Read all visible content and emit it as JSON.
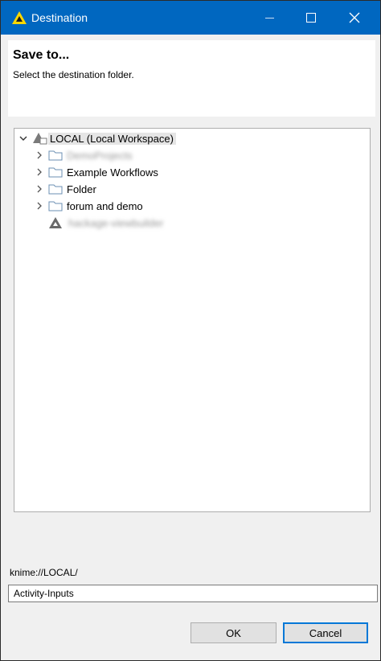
{
  "window": {
    "title": "Destination",
    "accent": "#0067c0",
    "controls": {
      "minimize": "—",
      "maximize": "□",
      "close": "✕"
    }
  },
  "header": {
    "title": "Save to...",
    "description": "Select the destination folder."
  },
  "tree": {
    "root": {
      "label": "LOCAL (Local Workspace)",
      "expanded": true,
      "selected": true
    },
    "items": [
      {
        "label": "DemoProjects",
        "blurred": true,
        "icon": "folder-icon"
      },
      {
        "label": "Example Workflows",
        "blurred": false,
        "icon": "folder-icon"
      },
      {
        "label": "Folder",
        "blurred": false,
        "icon": "folder-icon"
      },
      {
        "label": "forum and demo",
        "blurred": false,
        "icon": "folder-icon"
      },
      {
        "label": "hackage-viewbuilder",
        "blurred": true,
        "icon": "workflow-icon"
      }
    ]
  },
  "path": {
    "label": "knime://LOCAL/"
  },
  "name_field": {
    "value": "Activity-Inputs"
  },
  "buttons": {
    "ok": "OK",
    "cancel": "Cancel"
  }
}
